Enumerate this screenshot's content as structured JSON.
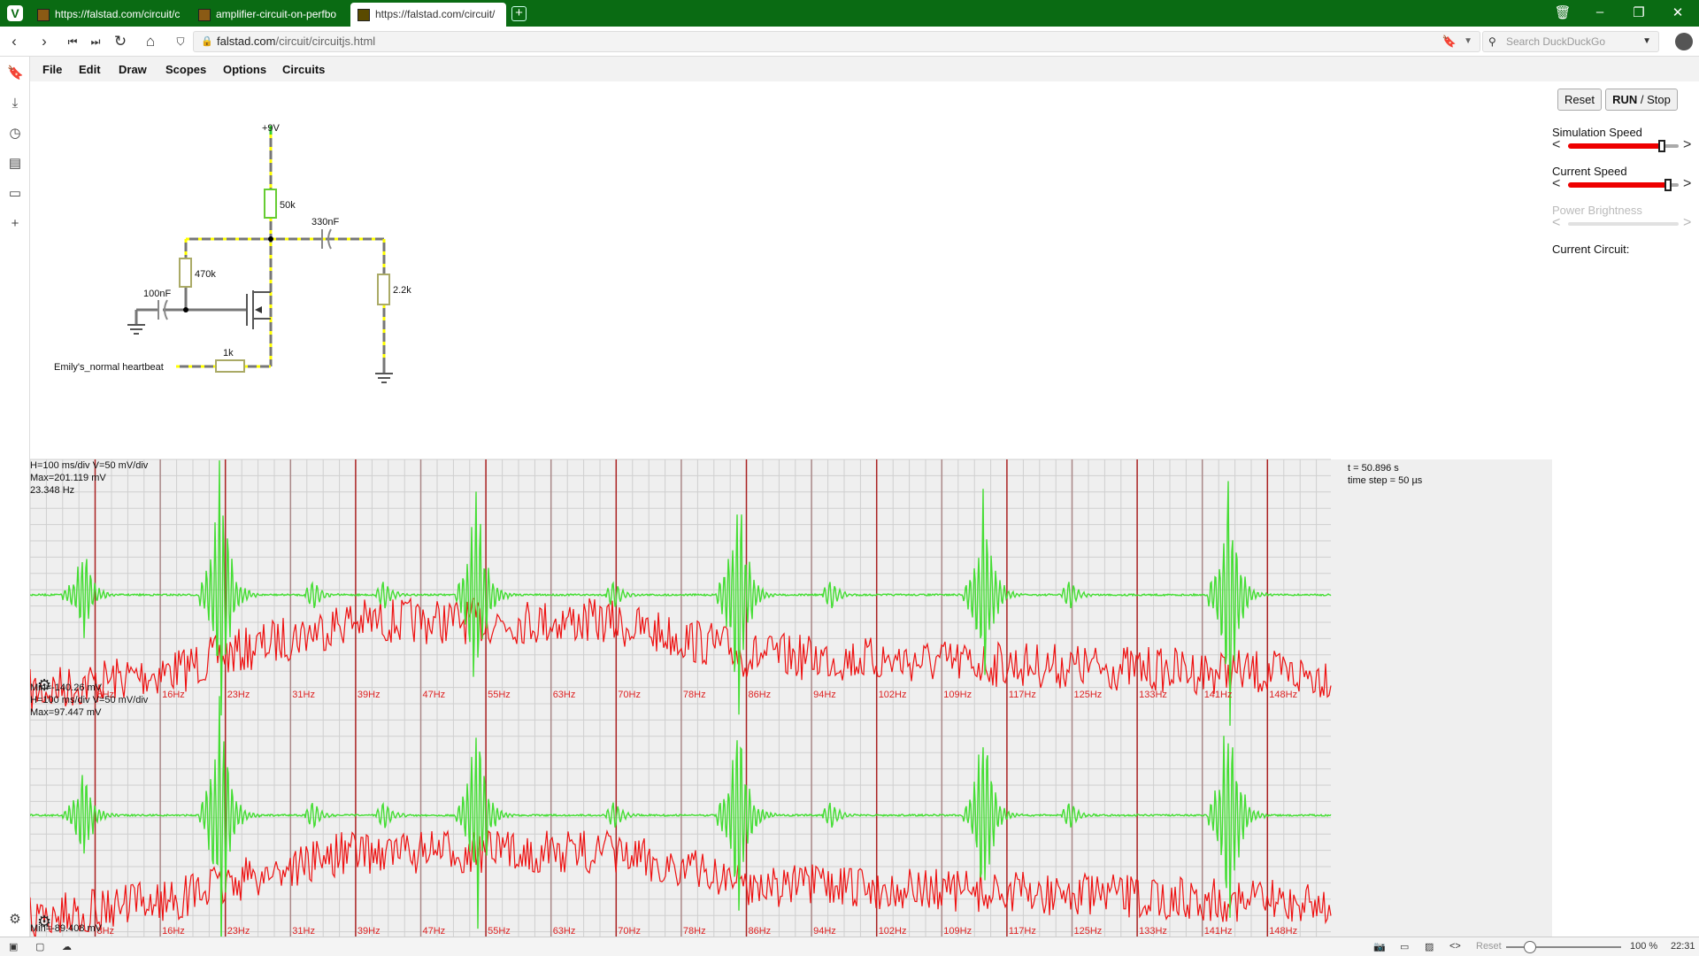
{
  "browser": {
    "tabs": [
      {
        "title": "https://falstad.com/circuit/c"
      },
      {
        "title": "amplifier-circuit-on-perfbo"
      },
      {
        "title": "https://falstad.com/circuit/"
      }
    ],
    "url_domain": "falstad.com",
    "url_path": "/circuit/circuitjs.html",
    "search_placeholder": "Search DuckDuckGo",
    "zoom": "100 %",
    "reset_label": "Reset",
    "clock": "22:31"
  },
  "menu": [
    "File",
    "Edit",
    "Draw",
    "Scopes",
    "Options",
    "Circuits"
  ],
  "controls": {
    "reset_label": "Reset",
    "run_stop_label_run": "RUN",
    "run_stop_label_stop": " / Stop",
    "sim_speed_label": "Simulation Speed",
    "sim_speed_value": 0.85,
    "current_speed_label": "Current Speed",
    "current_speed_value": 0.9,
    "power_brightness_label": "Power Brightness",
    "current_circuit_label": "Current Circuit:"
  },
  "circuit": {
    "supply": "+9V",
    "r_top": "50k",
    "cap_out": "330nF",
    "r_bias": "470k",
    "cap_in": "100nF",
    "r_load": "2.2k",
    "r_in": "1k",
    "source": "Emily's_normal heartbeat"
  },
  "scopes": {
    "time": "t = 50.896 s",
    "timestep": "time step = 50 µs",
    "scope1": {
      "settings": "H=100 ms/div V=50 mV/div",
      "max": "Max=201.119 mV",
      "freq": "23.348 Hz",
      "min": "Min=-140.26 mV"
    },
    "scope2": {
      "settings": "H=100 ms/div V=50 mV/div",
      "max": "Max=97.447 mV",
      "min": "Min=-89.408 mV"
    },
    "freq_labels": [
      "8Hz",
      "16Hz",
      "23Hz",
      "31Hz",
      "39Hz",
      "47Hz",
      "55Hz",
      "63Hz",
      "70Hz",
      "78Hz",
      "86Hz",
      "94Hz",
      "102Hz",
      "109Hz",
      "117Hz",
      "125Hz",
      "133Hz",
      "141Hz",
      "148Hz"
    ],
    "colors": {
      "green": "#44dd33",
      "red": "#ee1111",
      "grid": "#cfcfcf",
      "bg": "#efefef",
      "marker": "#aa2222"
    }
  }
}
